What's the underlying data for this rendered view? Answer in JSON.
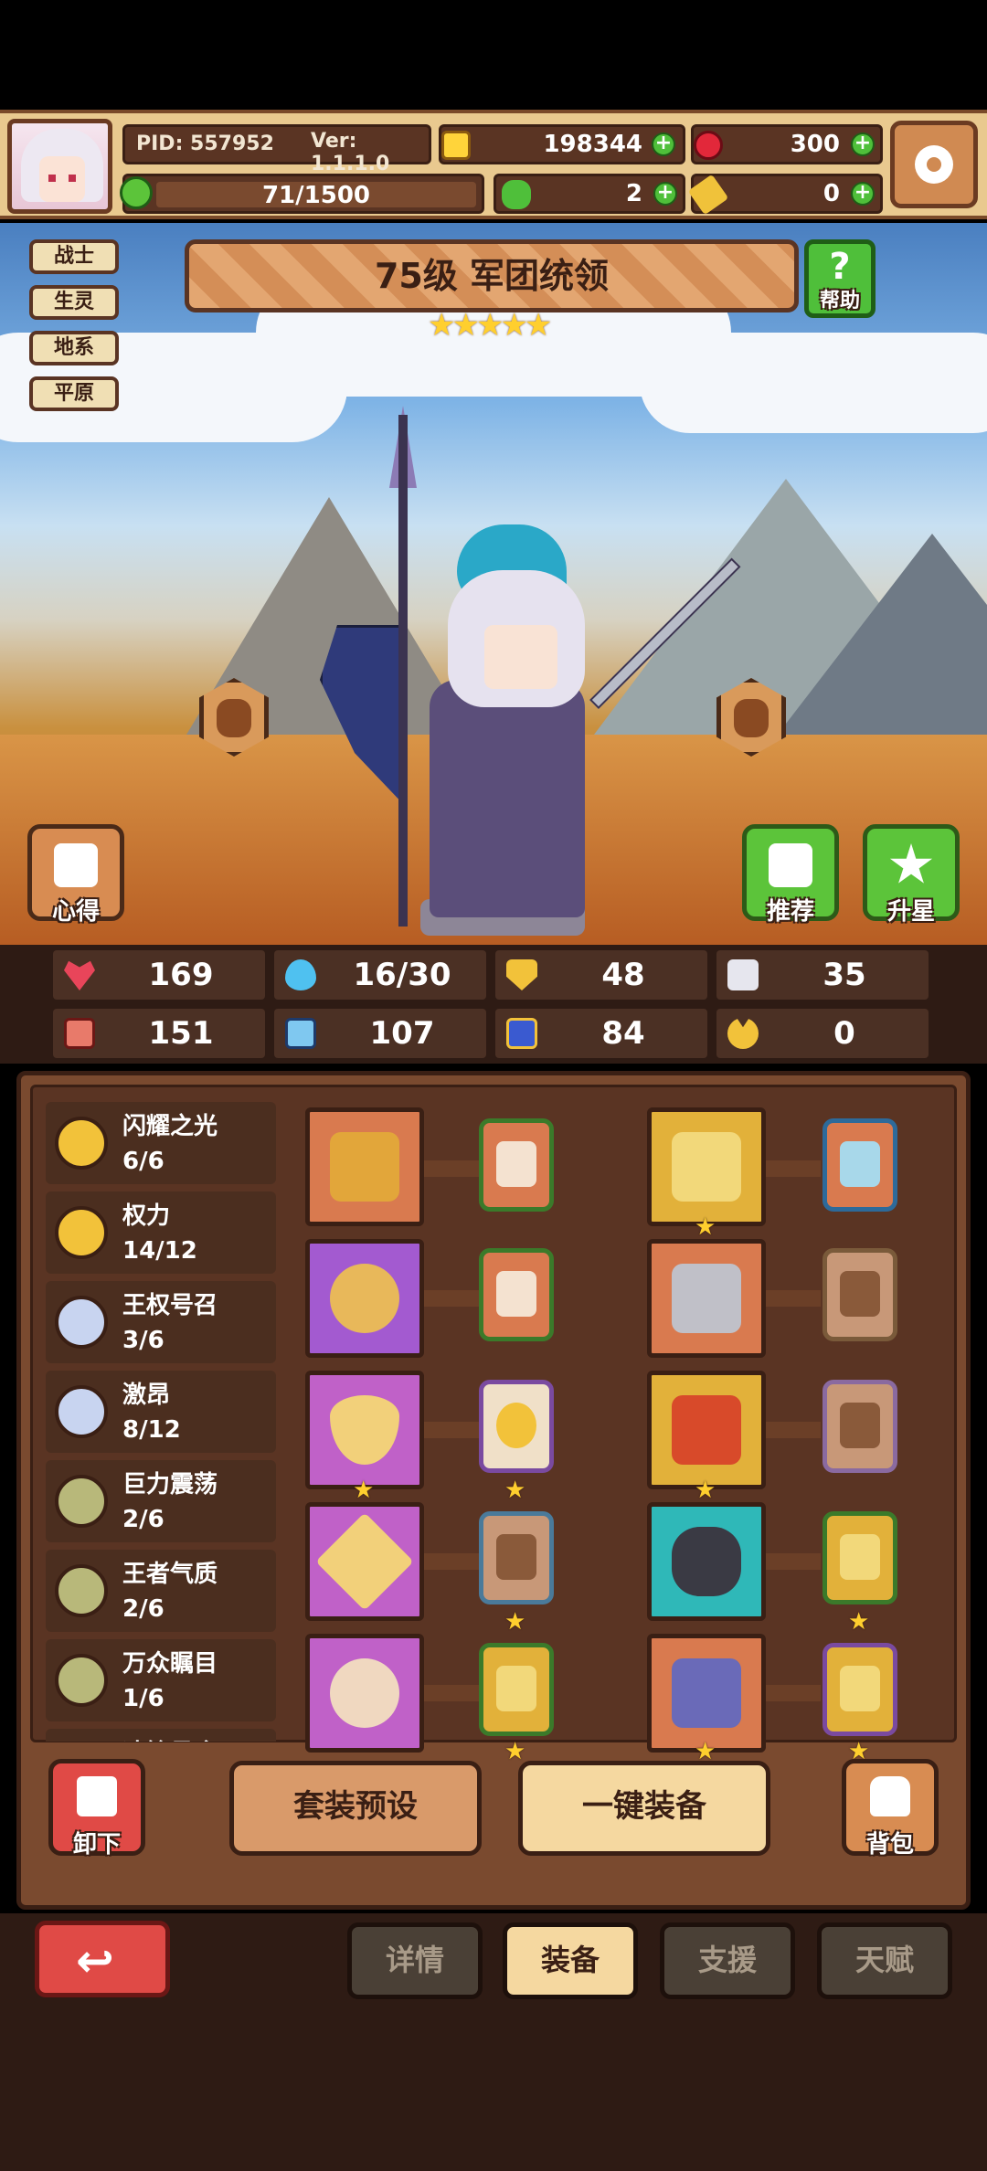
{
  "header": {
    "pid": "PID: 557952",
    "version": "Ver: 1.1.1.0",
    "gold": "198344",
    "ruby": "300",
    "energy": "71/1500",
    "clover": "2",
    "key": "0"
  },
  "tags": [
    "战士",
    "生灵",
    "地系",
    "平原"
  ],
  "hero": {
    "title": "75级  军团统领",
    "stars": "★★★★★",
    "help_label": "帮助"
  },
  "scene_buttons": {
    "insight": "心得",
    "recommend": "推荐",
    "upstar": "升星"
  },
  "stats": {
    "hp": "169",
    "mana": "16/30",
    "armor": "48",
    "speed": "35",
    "attack": "151",
    "magic": "107",
    "flag": "84",
    "crit": "0"
  },
  "sets": [
    {
      "name": "闪耀之光",
      "count": "6/6"
    },
    {
      "name": "权力",
      "count": "14/12"
    },
    {
      "name": "王权号召",
      "count": "3/6"
    },
    {
      "name": "激昂",
      "count": "8/12"
    },
    {
      "name": "巨力震荡",
      "count": "2/6"
    },
    {
      "name": "王者气质",
      "count": "2/6"
    },
    {
      "name": "万众瞩目",
      "count": "1/6"
    },
    {
      "name": "冲锋号令",
      "count": ""
    }
  ],
  "actions": {
    "unequip": "卸下",
    "preset": "套装预设",
    "auto_equip": "一键装备",
    "bag": "背包"
  },
  "tabs": [
    "详情",
    "装备",
    "支援",
    "天赋"
  ],
  "colors": {
    "orange_slot": "#d97a4f",
    "purple_slot": "#a35ad0",
    "gold_slot": "#e2b13a",
    "teal_slot": "#2fb8b8",
    "active_tab": "#f5d8a0",
    "inactive_tab": "#4a4036"
  }
}
